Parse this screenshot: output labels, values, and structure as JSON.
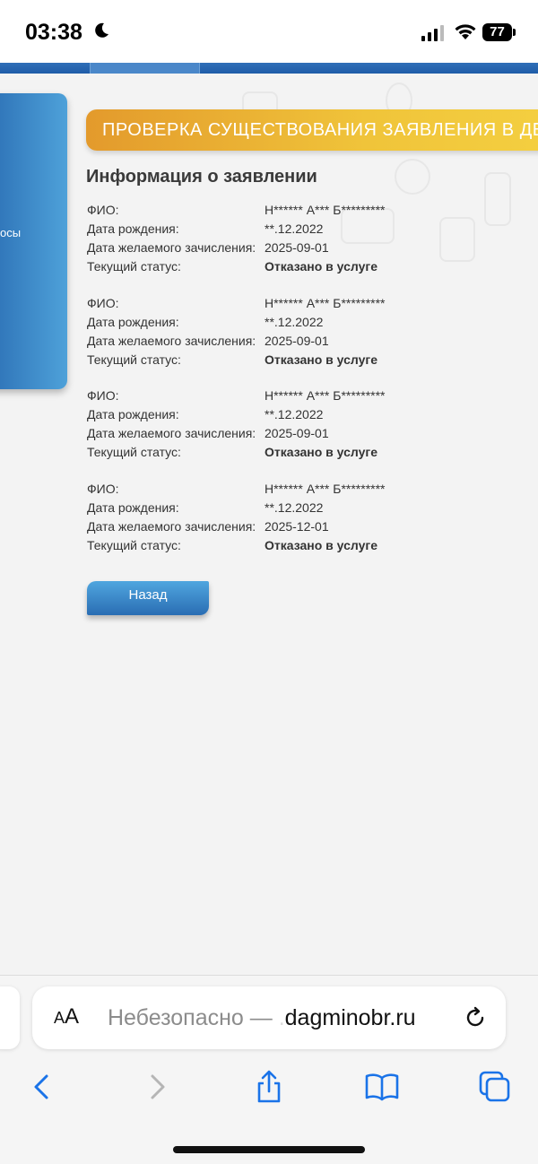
{
  "status_bar": {
    "time": "03:38",
    "battery": "77"
  },
  "sidebar": {
    "partial_text": "осы"
  },
  "banner": {
    "title": "ПРОВЕРКА СУЩЕСТВОВАНИЯ ЗАЯВЛЕНИЯ В ДЕ"
  },
  "section_title": "Информация о заявлении",
  "labels": {
    "fio": "ФИО:",
    "birth": "Дата рождения:",
    "enroll": "Дата желаемого зачисления:",
    "status": "Текущий статус:"
  },
  "records": [
    {
      "fio": "Н****** А*** Б*********",
      "birth": "**.12.2022",
      "enroll": "2025-09-01",
      "status": "Отказано в услуге"
    },
    {
      "fio": "Н****** А*** Б*********",
      "birth": "**.12.2022",
      "enroll": "2025-09-01",
      "status": "Отказано в услуге"
    },
    {
      "fio": "Н****** А*** Б*********",
      "birth": "**.12.2022",
      "enroll": "2025-09-01",
      "status": "Отказано в услуге"
    },
    {
      "fio": "Н****** А*** Б*********",
      "birth": "**.12.2022",
      "enroll": "2025-12-01",
      "status": "Отказано в услуге"
    }
  ],
  "back_button": "Назад",
  "safari": {
    "aa_small": "A",
    "aa_large": "A",
    "url_prefix": "Небезопасно — ",
    "url_hidden": ".",
    "url_domain": "dagminobr.ru"
  },
  "icons": [
    "moon-icon",
    "signal-icon",
    "wifi-icon",
    "battery-icon",
    "reload-icon",
    "back-arrow-icon",
    "forward-arrow-icon",
    "share-icon",
    "bookmarks-icon",
    "tabs-icon"
  ],
  "colors": {
    "accent_blue": "#2a6db3",
    "banner_orange": "#e39a2c",
    "banner_yellow": "#f4cf40",
    "safari_blue": "#1a73e8"
  }
}
